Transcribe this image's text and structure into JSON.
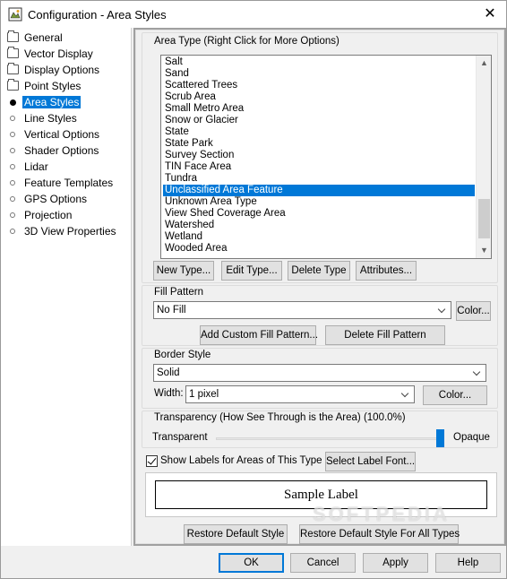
{
  "window": {
    "title": "Configuration - Area Styles",
    "close_glyph": "✕"
  },
  "nav": {
    "items": [
      {
        "label": "General",
        "icon": "folder-icon"
      },
      {
        "label": "Vector Display",
        "icon": "folder-icon"
      },
      {
        "label": "Display Options",
        "icon": "folder-icon"
      },
      {
        "label": "Point Styles",
        "icon": "folder-icon"
      },
      {
        "label": "Area Styles",
        "icon": "bullet-icon",
        "selected": true
      },
      {
        "label": "Line Styles",
        "icon": "bullet-icon"
      },
      {
        "label": "Vertical Options",
        "icon": "bullet-icon"
      },
      {
        "label": "Shader Options",
        "icon": "bullet-icon"
      },
      {
        "label": "Lidar",
        "icon": "bullet-icon"
      },
      {
        "label": "Feature Templates",
        "icon": "bullet-icon"
      },
      {
        "label": "GPS Options",
        "icon": "bullet-icon"
      },
      {
        "label": "Projection",
        "icon": "bullet-icon"
      },
      {
        "label": "3D View Properties",
        "icon": "bullet-icon"
      }
    ]
  },
  "area_type": {
    "heading": "Area Type (Right Click for More Options)",
    "items": [
      "Salt",
      "Sand",
      "Scattered Trees",
      "Scrub Area",
      "Small Metro Area",
      "Snow or Glacier",
      "State",
      "State Park",
      "Survey Section",
      "TIN Face Area",
      "Tundra",
      "Unclassified Area Feature",
      "Unknown Area Type",
      "View Shed Coverage Area",
      "Watershed",
      "Wetland",
      "Wooded Area"
    ],
    "selected_item": "Unclassified Area Feature",
    "buttons": {
      "new": "New Type...",
      "edit": "Edit Type...",
      "delete": "Delete Type",
      "attributes": "Attributes..."
    }
  },
  "fill_pattern": {
    "heading": "Fill Pattern",
    "value": "No Fill",
    "color_button": "Color...",
    "add_custom": "Add Custom Fill Pattern...",
    "delete": "Delete Fill Pattern"
  },
  "border_style": {
    "heading": "Border Style",
    "value": "Solid",
    "width_label": "Width:",
    "width_value": "1 pixel",
    "color_button": "Color..."
  },
  "transparency": {
    "heading": "Transparency (How See Through is the Area) (100.0%)",
    "left_label": "Transparent",
    "right_label": "Opaque",
    "level": 1.0
  },
  "labels": {
    "checkbox_label": "Show Labels for Areas of This Type",
    "checked": true,
    "select_font": "Select Label Font...",
    "sample": "Sample Label"
  },
  "restore": {
    "default_style": "Restore Default Style",
    "all_types": "Restore Default Style For All Types"
  },
  "footer": {
    "ok": "OK",
    "cancel": "Cancel",
    "apply": "Apply",
    "help": "Help"
  },
  "watermark": "SOFTPEDIA",
  "colors": {
    "selection": "#0078d7",
    "dialog_bg": "#f0f0f0",
    "content_border": "#a0a0a0"
  }
}
